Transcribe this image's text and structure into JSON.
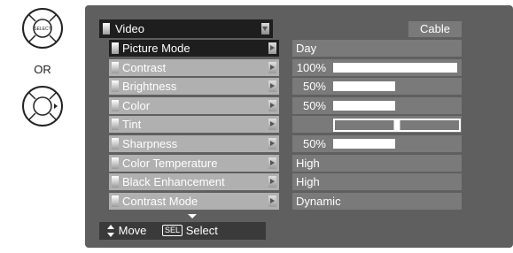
{
  "remote": {
    "select_label": "SELECT",
    "or_label": "OR",
    "top_button_icon": "select-dpad-icon",
    "bottom_button_icon": "right-dpad-icon"
  },
  "menu": {
    "title": "Video",
    "source": "Cable",
    "rows": [
      {
        "label": "Picture Mode",
        "value": "Day",
        "selected": true
      },
      {
        "label": "Contrast",
        "value": "100%",
        "level": 1.0
      },
      {
        "label": "Brightness",
        "value": "50%",
        "level": 0.5
      },
      {
        "label": "Color",
        "value": "50%",
        "level": 0.5
      },
      {
        "label": "Tint",
        "value": "",
        "position": 0.5
      },
      {
        "label": "Sharpness",
        "value": "50%",
        "level": 0.5
      },
      {
        "label": "Color Temperature",
        "value": "High"
      },
      {
        "label": "Black Enhancement",
        "value": "High"
      },
      {
        "label": "Contrast Mode",
        "value": "Dynamic"
      }
    ]
  },
  "footer": {
    "move_label": "Move",
    "sel_badge": "SEL",
    "select_label": "Select"
  },
  "colors": {
    "screen_bg": "#5f5f5f",
    "label_bg": "#b0b0b0",
    "value_bg": "#7a7a7a",
    "selected_bg": "#1e1e1e"
  }
}
